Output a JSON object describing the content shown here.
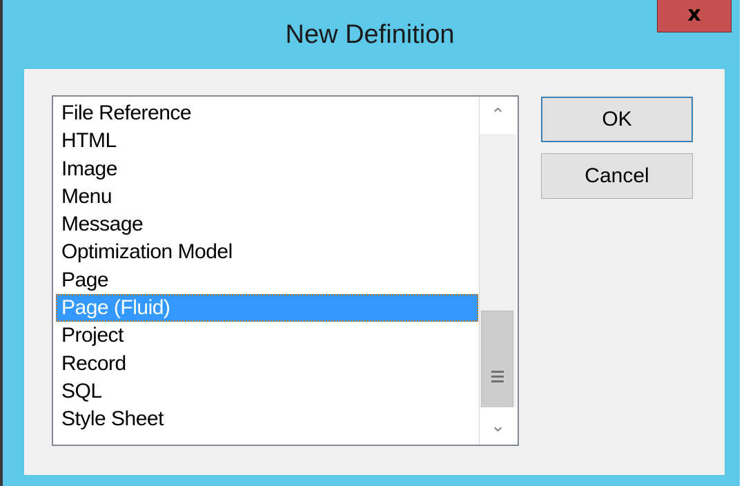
{
  "window": {
    "title": "New Definition",
    "close_glyph": "x"
  },
  "list": {
    "items": [
      {
        "label": "File Reference"
      },
      {
        "label": "HTML"
      },
      {
        "label": "Image"
      },
      {
        "label": "Menu"
      },
      {
        "label": "Message"
      },
      {
        "label": "Optimization Model"
      },
      {
        "label": "Page"
      },
      {
        "label": "Page (Fluid)"
      },
      {
        "label": "Project"
      },
      {
        "label": "Record"
      },
      {
        "label": "SQL"
      },
      {
        "label": "Style Sheet"
      }
    ],
    "selected_index": 7,
    "scroll_up_icon": "chevron-up-icon",
    "scroll_down_icon": "chevron-down-icon",
    "scroll_thumb_grip_icon": "grip-icon"
  },
  "buttons": {
    "ok_label": "OK",
    "cancel_label": "Cancel"
  },
  "colors": {
    "frame": "#5dc8e8",
    "close": "#c75050",
    "selection": "#3399ff"
  }
}
